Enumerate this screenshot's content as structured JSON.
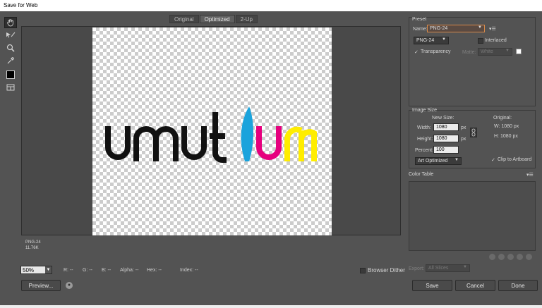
{
  "window": {
    "title": "Save for Web"
  },
  "tabs": [
    {
      "label": "Original"
    },
    {
      "label": "Optimized"
    },
    {
      "label": "2-Up"
    }
  ],
  "tools": [
    {
      "icon": "hand-icon"
    },
    {
      "icon": "slice-select-icon"
    },
    {
      "icon": "zoom-icon"
    },
    {
      "icon": "eyedropper-icon"
    },
    {
      "icon": "eyedropper-color-swatch",
      "color": "#000000"
    },
    {
      "icon": "toggle-slices-icon"
    }
  ],
  "preview": {
    "logo_colors": {
      "dark": "#111111",
      "cyan": "#1aa3dc",
      "magenta": "#e6007e",
      "yellow": "#ffed00"
    },
    "file_format": "PNG-24",
    "file_size": "11.76K"
  },
  "status": {
    "zoom": "50%",
    "r": "R: --",
    "g": "G: --",
    "b": "B: --",
    "alpha": "Alpha: --",
    "hex": "Hex: --",
    "index": "Index: --",
    "browser_dither": "Browser Dither"
  },
  "buttons": {
    "preview": "Preview...",
    "save": "Save",
    "cancel": "Cancel",
    "done": "Done"
  },
  "preset": {
    "section_title": "Preset",
    "name_label": "Name:",
    "name_value": "PNG-24",
    "format": "PNG-24",
    "interlaced": "Interlaced",
    "transparency": "Transparency",
    "matte_label": "Matte:",
    "matte_value": "White"
  },
  "image_size": {
    "section_title": "Image Size",
    "new_size": "New Size:",
    "original": "Original:",
    "width_label": "Width:",
    "width_value": "1080",
    "height_label": "Height:",
    "height_value": "1080",
    "unit": "px",
    "percent_label": "Percent:",
    "percent_value": "100",
    "orig_w": "W:  1080 px",
    "orig_h": "H:  1080 px",
    "quality": "Art Optimized",
    "clip": "Clip to Artboard"
  },
  "color_table": {
    "section_title": "Color Table",
    "export_label": "Export:",
    "export_value": "All Slices"
  }
}
